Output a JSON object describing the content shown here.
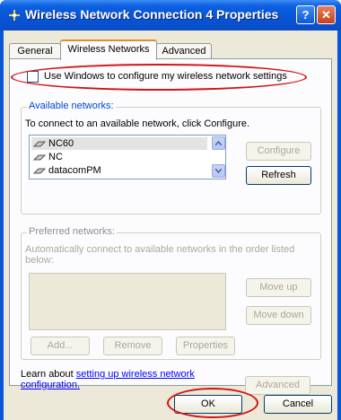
{
  "window": {
    "title": "Wireless Network Connection 4 Properties",
    "help_glyph": "?",
    "close_glyph": "✕"
  },
  "tabs": [
    {
      "label": "General"
    },
    {
      "label": "Wireless Networks"
    },
    {
      "label": "Advanced"
    }
  ],
  "use_windows": {
    "label": "Use Windows to configure my wireless network settings",
    "checked": false
  },
  "available": {
    "title": "Available networks:",
    "instruction": "To connect to an available network, click Configure.",
    "networks": [
      {
        "name": "NC60",
        "selected": true
      },
      {
        "name": "NC",
        "selected": false
      },
      {
        "name": "datacomPM",
        "selected": false
      }
    ],
    "configure_label": "Configure",
    "refresh_label": "Refresh"
  },
  "preferred": {
    "title": "Preferred networks:",
    "description": "Automatically connect to available networks in the order listed below:",
    "move_up_label": "Move up",
    "move_down_label": "Move down",
    "add_label": "Add...",
    "remove_label": "Remove",
    "properties_label": "Properties"
  },
  "learn": {
    "prefix": "Learn about ",
    "link_line1": "setting up wireless network",
    "link_line2": "configuration.",
    "advanced_label": "Advanced"
  },
  "footer": {
    "ok_label": "OK",
    "cancel_label": "Cancel"
  },
  "colors": {
    "titlebar": "#0754d6",
    "dialog_bg": "#ece9d8",
    "group_title": "#0046d5",
    "annotation": "#d21414"
  }
}
